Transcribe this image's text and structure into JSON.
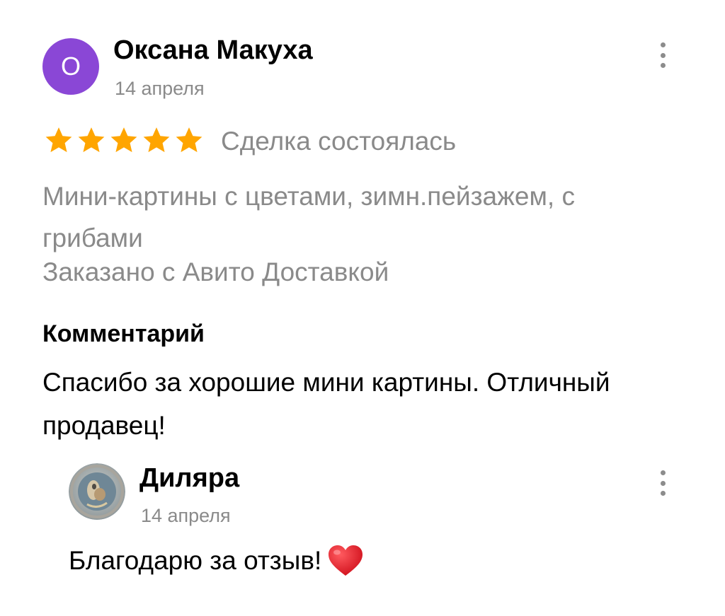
{
  "review": {
    "author": {
      "avatar_letter": "О",
      "avatar_color": "#8a47d6",
      "name": "Оксана Макуха",
      "date": "14 апреля"
    },
    "rating": 5,
    "rating_max": 5,
    "star_color": "#ffa500",
    "deal_status": "Сделка состоялась",
    "item_title": "Мини-картины с цветами, зимн.пейзажем, с грибами",
    "delivery": "Заказано с Авито Доставкой",
    "comment_heading": "Комментарий",
    "comment_text": "Спасибо за хорошие мини картины. Отличный продавец!",
    "more_icon": "more-vertical-icon"
  },
  "reply": {
    "author": {
      "name": "Диляра",
      "date": "14 апреля",
      "avatar": "seller-photo"
    },
    "text": "Благодарю за отзыв!",
    "emoji": "heart-icon",
    "heart_color": "#e0232e",
    "more_icon": "more-vertical-icon"
  }
}
